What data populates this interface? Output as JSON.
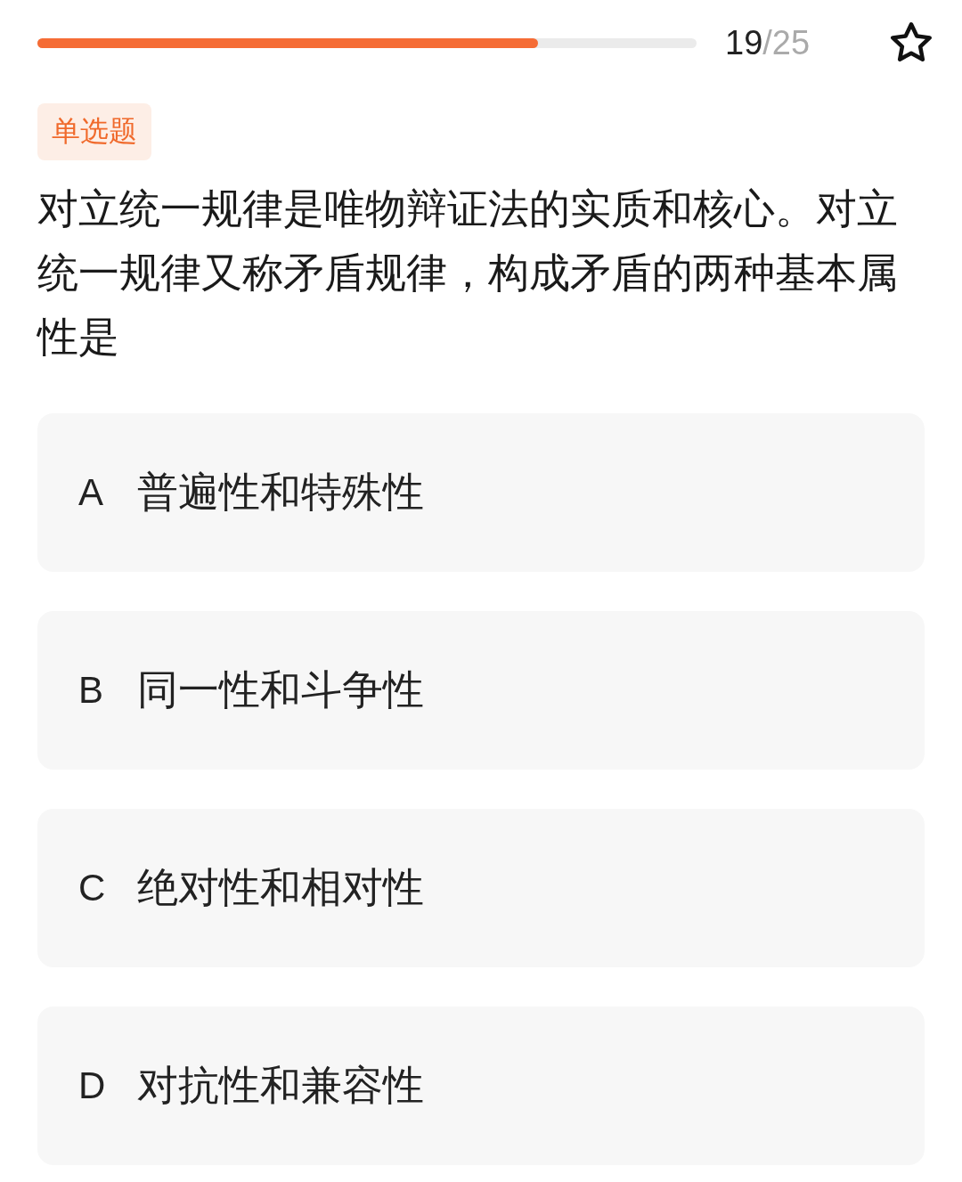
{
  "progress": {
    "level": 0.76,
    "current": "19",
    "total": "/25"
  },
  "question": {
    "type": "单选题",
    "text": "对立统一规律是唯物辩证法的实质和核心。对立统一规律又称矛盾规律，构成矛盾的两种基本属性是"
  },
  "options": [
    {
      "letter": "A",
      "text": "普遍性和特殊性",
      "selected": false
    },
    {
      "letter": "B",
      "text": "同一性和斗争性",
      "selected": false
    },
    {
      "letter": "C",
      "text": "绝对性和相对性",
      "selected": false
    },
    {
      "letter": "D",
      "text": "对抗性和兼容性",
      "selected": false
    }
  ]
}
